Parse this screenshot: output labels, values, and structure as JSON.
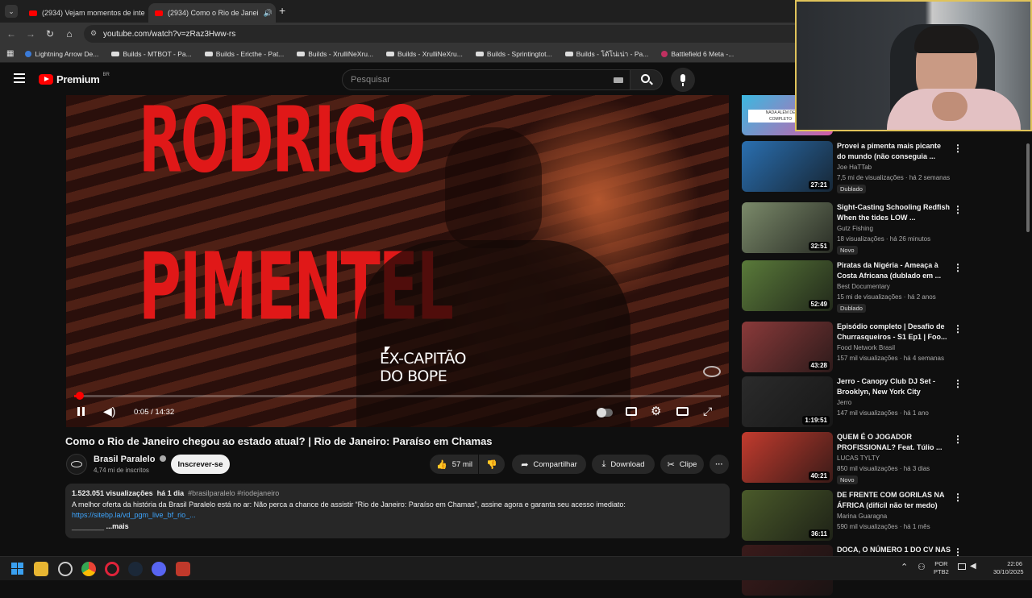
{
  "browser": {
    "tabs": [
      {
        "title": "(2934) Vejam momentos de inte",
        "active": false
      },
      {
        "title": "(2934) Como o Rio de Janei",
        "active": true
      }
    ],
    "url": "youtube.com/watch?v=zRaz3Hww-rs",
    "bookmarks": [
      "Lightning Arrow De...",
      "Builds - MTBOT - Pa...",
      "Builds - Ericthe - Pat...",
      "Builds - XrulliNeXru...",
      "Builds - XrulliNeXru...",
      "Builds - Sprintingtot...",
      "Builds - โต้โน่เน่า - Pa...",
      "Battlefield 6 Meta -..."
    ]
  },
  "header": {
    "logo": "Premium",
    "region": "BR",
    "search_placeholder": "Pesquisar"
  },
  "player": {
    "overlay_name_line1": "RODRIGO",
    "overlay_name_line2": "PIMENTEL",
    "overlay_caption_line1": "EX-CAPITÃO",
    "overlay_caption_line2": "DO BOPE",
    "time": "0:05 / 14:32",
    "progress_percent": 0.6
  },
  "video": {
    "title": "Como o Rio de Janeiro chegou ao estado atual? | Rio de Janeiro: Paraíso em Chamas",
    "channel": "Brasil Paralelo",
    "subscribers": "4,74 mi de inscritos",
    "subscribe_label": "Inscrever-se",
    "likes": "57 mil",
    "share_label": "Compartilhar",
    "download_label": "Download",
    "clip_label": "Clipe",
    "views": "1.523.051 visualizações",
    "age": "há 1 dia",
    "hashtags": "#brasilparalelo #riodejaneiro",
    "description": "A melhor oferta da história da Brasil Paralelo está no ar: Não perca a chance de assistir “Rio de Janeiro: Paraíso em Chamas”, assine agora e garanta seu acesso imediato:",
    "link": "https://sitebp.la/vd_pgm_live_bf_rio_...",
    "more_label": "...mais",
    "more_prefix": "________"
  },
  "recommendations": [
    {
      "title": "Provei a pimenta mais picante do mundo (não conseguia ...",
      "channel": "Joe HaTTab",
      "meta": "7,5 mi de visualizações · há 2 semanas",
      "duration": "27:21",
      "badge": "Dublado",
      "thumb_color": "#2a6fb0"
    },
    {
      "title": "Sight-Casting Schooling Redfish When the tides LOW ...",
      "channel": "Gutz Fishing",
      "meta": "18 visualizações · há 26 minutos",
      "duration": "32:51",
      "badge": "Novo",
      "thumb_color": "#7b8a6a"
    },
    {
      "title": "Piratas da Nigéria - Ameaça à Costa Africana (dublado em ...",
      "channel": "Best Documentary",
      "meta": "15 mi de visualizações · há 2 anos",
      "duration": "52:49",
      "badge": "Dublado",
      "thumb_color": "#5a7a3a"
    },
    {
      "title": "Episódio completo | Desafio de Churrasqueiros - S1 Ep1 | Foo...",
      "channel": "Food Network Brasil",
      "meta": "157 mil visualizações · há 4 semanas",
      "duration": "43:28",
      "badge": "",
      "thumb_color": "#8a3a3a"
    },
    {
      "title": "Jerro - Canopy Club DJ Set - Brooklyn, New York City",
      "channel": "Jerro",
      "meta": "147 mil visualizações · há 1 ano",
      "duration": "1:19:51",
      "badge": "",
      "thumb_color": "#2b2b2b"
    },
    {
      "title": "QUEM É O JOGADOR PROFISSIONAL? Feat. Túlio ...",
      "channel": "LUCAS TYLTY",
      "meta": "850 mil visualizações · há 3 dias",
      "duration": "40:21",
      "badge": "Novo",
      "thumb_color": "#c23b2e"
    },
    {
      "title": "DE FRENTE COM GORILAS NA ÁFRICA (difícil não ter medo)",
      "channel": "Marina Guaragna",
      "meta": "590 mil visualizações · há 1 mês",
      "duration": "36:11",
      "badge": "",
      "thumb_color": "#4a5a2a"
    },
    {
      "title": "DOCA, O NÚMERO 1 DO CV NAS",
      "channel": "",
      "meta": "",
      "duration": "",
      "badge": "",
      "thumb_color": "#3a1a1a"
    }
  ],
  "top_thumb_caption": "NADA ALÉM DE\nCOMPLETO",
  "taskbar": {
    "lang": "POR",
    "layout": "PTB2",
    "time": "22:06",
    "date": "30/10/2025"
  }
}
